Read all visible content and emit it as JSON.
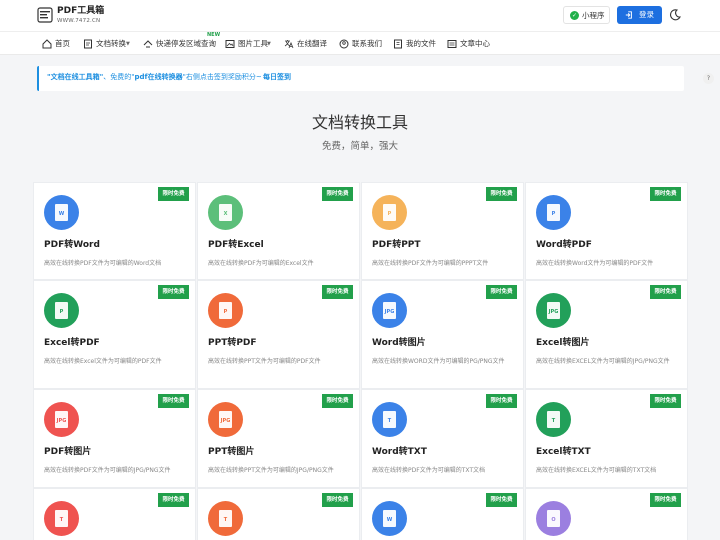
{
  "header": {
    "logo_title": "PDF工具箱",
    "logo_subtitle": "WWW.7472.CN",
    "logo_box_text": "PDF",
    "miniprogram_label": "小程序",
    "login_label": "登录",
    "accent": "#1d6fe0"
  },
  "nav": {
    "new_badge": "NEW",
    "items": [
      {
        "label": "首页",
        "icon": "home-icon"
      },
      {
        "label": "文档转换",
        "icon": "doc-convert-icon",
        "dropdown": true
      },
      {
        "label": "快递停发区域查询",
        "icon": "delivery-icon"
      },
      {
        "label": "图片工具",
        "icon": "image-icon",
        "dropdown": true
      },
      {
        "label": "在线翻译",
        "icon": "translate-icon"
      },
      {
        "label": "联系我们",
        "icon": "contact-icon"
      },
      {
        "label": "我的文件",
        "icon": "file-icon"
      },
      {
        "label": "文章中心",
        "icon": "article-icon"
      }
    ]
  },
  "notice": {
    "part1": "\"文档在线工具箱\"",
    "part2": "、免费的\"",
    "part3": "pdf在线转换器",
    "part4": "\"右侧点击签到奖励积分~",
    "sign": "每日签到",
    "help": "?"
  },
  "hero": {
    "title": "文档转换工具",
    "subtitle": "免费，简单，强大"
  },
  "badge_label": "限时免费",
  "tools": [
    {
      "title": "PDF转Word",
      "desc": "高效在线转换PDF文件为可编辑的Word文档",
      "color": "#3b82e8",
      "sym": "W"
    },
    {
      "title": "PDF转Excel",
      "desc": "高效在线转换PDF为可编辑的Excel文件",
      "color": "#5cbf7a",
      "sym": "X"
    },
    {
      "title": "PDF转PPT",
      "desc": "高效在线转换PDF文件为可编辑的PPPT文件",
      "color": "#f5b35a",
      "sym": "P"
    },
    {
      "title": "Word转PDF",
      "desc": "高效在线转换Word文件为可编辑的PDF文件",
      "color": "#3b82e8",
      "sym": "P"
    },
    {
      "title": "Excel转PDF",
      "desc": "高效在线转换Excel文件为可编辑的PDF文件",
      "color": "#22a05a",
      "sym": "P"
    },
    {
      "title": "PPT转PDF",
      "desc": "高效在线转换PPT文件为可编辑的PDF文件",
      "color": "#f06a3a",
      "sym": "P"
    },
    {
      "title": "Word转图片",
      "desc": "高效在线转换WORD文件为可编辑的PG/PNG文件",
      "color": "#3b82e8",
      "sym": "JPG"
    },
    {
      "title": "Excel转图片",
      "desc": "高效在线转换EXCEL文件为可编辑的JPG/PNG文件",
      "color": "#22a05a",
      "sym": "JPG"
    },
    {
      "title": "PDF转图片",
      "desc": "高效在线转换PDF文件为可编辑的JPG/PNG文件",
      "color": "#ef5350",
      "sym": "JPG"
    },
    {
      "title": "PPT转图片",
      "desc": "高效在线转换PPT文件为可编辑的JPG/PNG文件",
      "color": "#f06a3a",
      "sym": "JPG"
    },
    {
      "title": "Word转TXT",
      "desc": "高效在线转换PDF文件为可编辑的TXT文档",
      "color": "#3b82e8",
      "sym": "T"
    },
    {
      "title": "Excel转TXT",
      "desc": "高效在线转换EXCEL文件为可编辑的TXT文档",
      "color": "#22a05a",
      "sym": "T"
    },
    {
      "title": "",
      "desc": "",
      "color": "#ef5350",
      "sym": "T"
    },
    {
      "title": "",
      "desc": "",
      "color": "#f06a3a",
      "sym": "T"
    },
    {
      "title": "",
      "desc": "",
      "color": "#3b82e8",
      "sym": "W"
    },
    {
      "title": "",
      "desc": "",
      "color": "#9b7fe0",
      "sym": "O"
    }
  ]
}
